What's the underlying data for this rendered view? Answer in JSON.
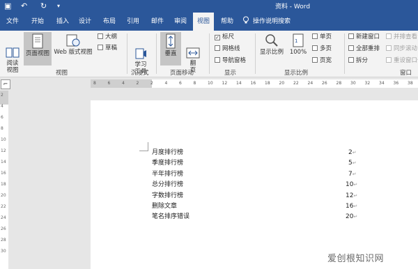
{
  "window": {
    "title": "资料 - Word"
  },
  "quick_access": {
    "save": "▣",
    "undo": "↶",
    "redo": "↻",
    "customize": "▾"
  },
  "tabs": [
    "文件",
    "开始",
    "插入",
    "设计",
    "布局",
    "引用",
    "邮件",
    "审阅",
    "视图",
    "帮助"
  ],
  "active_tab": "视图",
  "tell_me": "操作说明搜索",
  "ribbon": {
    "views": {
      "read_mode": "阅读\n视图",
      "print_layout": "页面视图",
      "web_layout": "Web 版式视图",
      "outline": "大纲",
      "draft": "草稿",
      "group_label": "视图"
    },
    "immersive": {
      "learning_tools": "学习\n工具",
      "group_label": "沉浸式"
    },
    "page_movement": {
      "vertical": "垂直",
      "side_to_side": "翻\n页",
      "group_label": "页面移动"
    },
    "show": {
      "ruler": "标尺",
      "ruler_checked": true,
      "gridlines": "网格线",
      "nav_pane": "导航窗格",
      "group_label": "显示"
    },
    "zoom": {
      "zoom": "显示比例",
      "hundred": "100%",
      "one_page": "单页",
      "multi_page": "多页",
      "page_width": "页宽",
      "group_label": "显示比例"
    },
    "window": {
      "new_window": "新建窗口",
      "arrange_all": "全部重排",
      "split": "拆分",
      "side_by_side": "并排查看",
      "sync_scroll": "同步滚动",
      "reset_pos": "重设窗口位置",
      "group_label": "窗口"
    }
  },
  "hruler_ticks": [
    "8",
    "6",
    "4",
    "2",
    "2",
    "4",
    "6",
    "8",
    "10",
    "12",
    "14",
    "16",
    "18",
    "20",
    "22",
    "24",
    "26",
    "28",
    "30",
    "32",
    "34",
    "36",
    "38"
  ],
  "vruler_ticks": [
    "2",
    "4",
    "6",
    "8",
    "10",
    "12",
    "14",
    "16",
    "18",
    "20",
    "22",
    "24",
    "26",
    "28",
    "30"
  ],
  "document": {
    "rows": [
      {
        "label": "月度排行榜",
        "value": "2"
      },
      {
        "label": "季度排行榜",
        "value": "5"
      },
      {
        "label": "半年排行榜",
        "value": "7"
      },
      {
        "label": "总分排行榜",
        "value": "10"
      },
      {
        "label": "字数排行榜",
        "value": "12"
      },
      {
        "label": "删除文章",
        "value": "16"
      },
      {
        "label": "笔名排序错误",
        "value": "20"
      }
    ],
    "return_mark": "↵"
  },
  "watermark": "爱创根知识网"
}
